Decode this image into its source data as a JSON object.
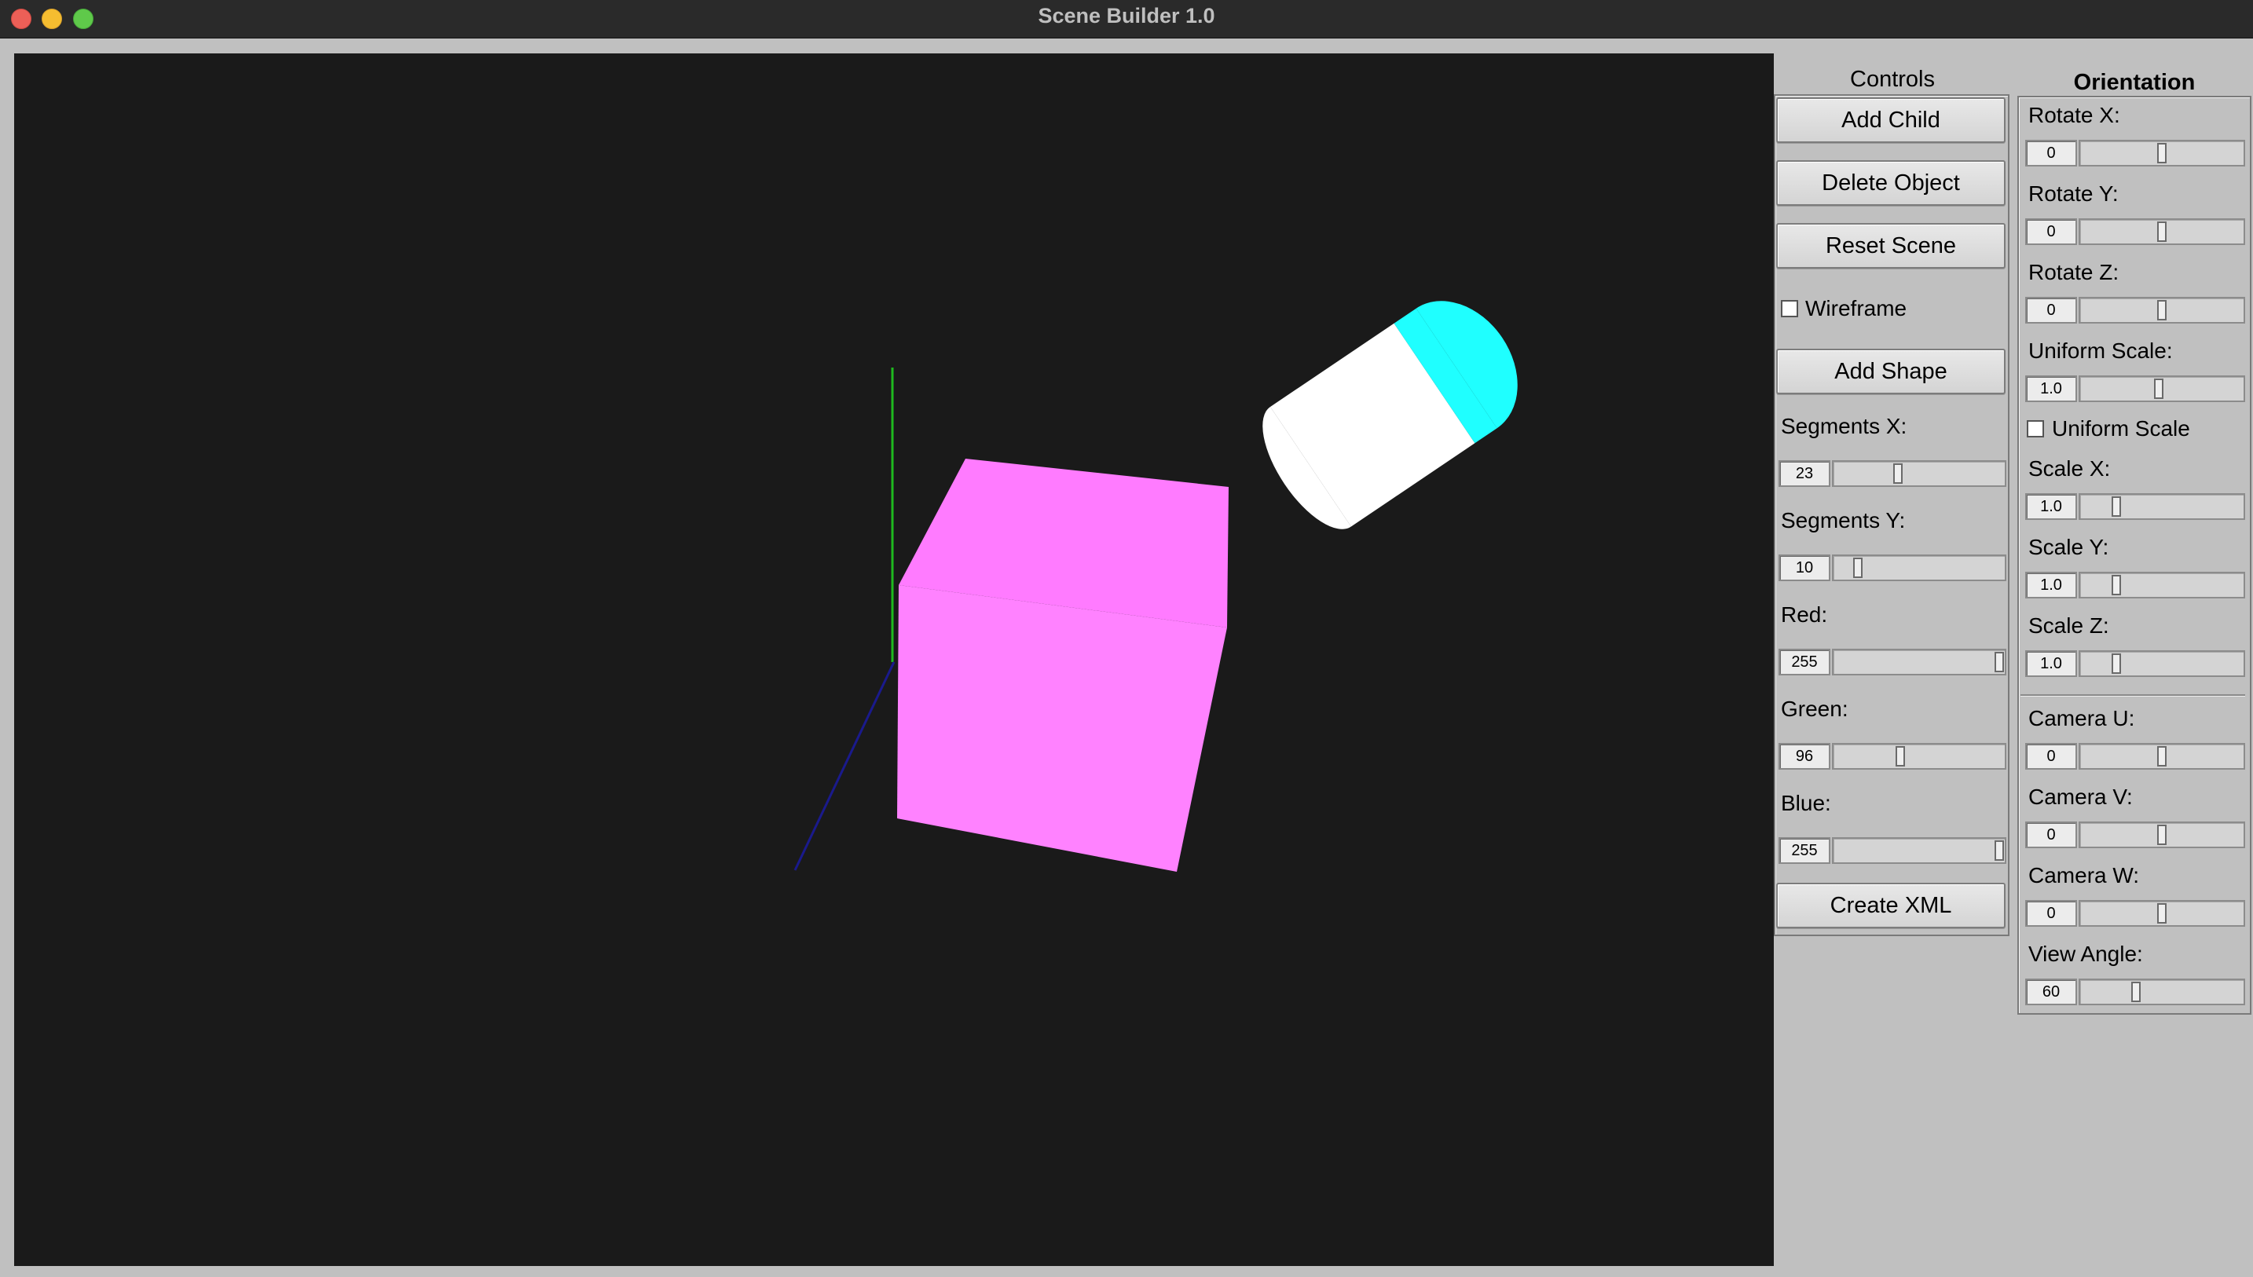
{
  "window": {
    "title": "Scene Builder 1.0",
    "traffic_colors": {
      "close": "#ec5f57",
      "minimize": "#f5bd30",
      "maximize": "#5fc94a"
    }
  },
  "scene": {
    "background": "#1a1a1a",
    "axes": {
      "y_color": "#1fb91f",
      "z_color": "#1a1a8c"
    },
    "cube": {
      "top_color": "#ff7bff",
      "front_color": "#ff82ff"
    },
    "capsule": {
      "body_color": "#ffffff",
      "cap_color": "#1fffff"
    }
  },
  "controls": {
    "title": "Controls",
    "add_child": "Add Child",
    "delete_object": "Delete Object",
    "reset_scene": "Reset Scene",
    "wireframe_label": "Wireframe",
    "wireframe_checked": false,
    "add_shape": "Add Shape",
    "segments_x": {
      "label": "Segments X:",
      "value": "23",
      "level": 0.37
    },
    "segments_y": {
      "label": "Segments Y:",
      "value": "10",
      "level": 0.12
    },
    "red": {
      "label": "Red:",
      "value": "255",
      "level": 1.0
    },
    "green": {
      "label": "Green:",
      "value": "96",
      "level": 0.38
    },
    "blue": {
      "label": "Blue:",
      "value": "255",
      "level": 1.0
    },
    "create_xml": "Create XML"
  },
  "orientation": {
    "title": "Orientation",
    "rotate_x": {
      "label": "Rotate X:",
      "value": "0",
      "level": 0.5
    },
    "rotate_y": {
      "label": "Rotate Y:",
      "value": "0",
      "level": 0.5
    },
    "rotate_z": {
      "label": "Rotate Z:",
      "value": "0",
      "level": 0.5
    },
    "uniform_scale": {
      "label": "Uniform Scale:",
      "value": "1.0",
      "level": 0.48
    },
    "uniform_scale_check": "Uniform Scale",
    "uniform_scale_checked": false,
    "scale_x": {
      "label": "Scale X:",
      "value": "1.0",
      "level": 0.2
    },
    "scale_y": {
      "label": "Scale Y:",
      "value": "1.0",
      "level": 0.2
    },
    "scale_z": {
      "label": "Scale Z:",
      "value": "1.0",
      "level": 0.2
    },
    "camera_u": {
      "label": "Camera U:",
      "value": "0",
      "level": 0.5
    },
    "camera_v": {
      "label": "Camera V:",
      "value": "0",
      "level": 0.5
    },
    "camera_w": {
      "label": "Camera W:",
      "value": "0",
      "level": 0.5
    },
    "view_angle": {
      "label": "View Angle:",
      "value": "60",
      "level": 0.33
    }
  }
}
